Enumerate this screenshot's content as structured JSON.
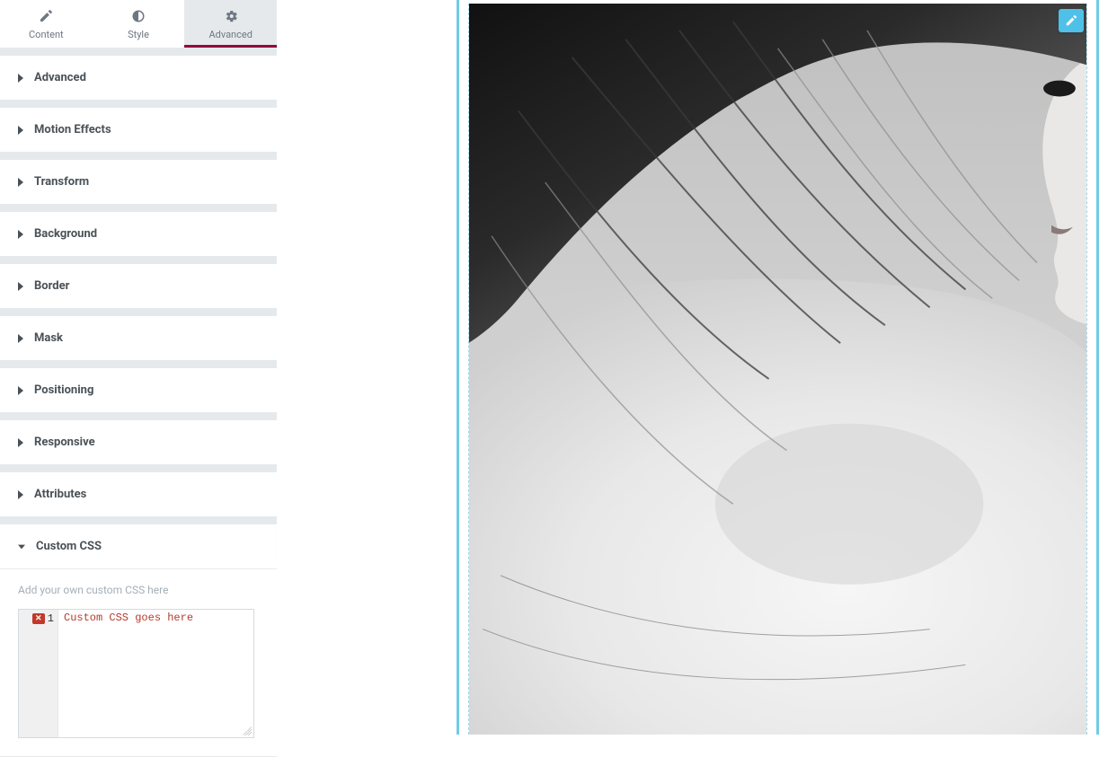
{
  "tabs": {
    "content": "Content",
    "style": "Style",
    "advanced": "Advanced"
  },
  "sections": {
    "advanced": "Advanced",
    "motion_effects": "Motion Effects",
    "transform": "Transform",
    "background": "Background",
    "border": "Border",
    "mask": "Mask",
    "positioning": "Positioning",
    "responsive": "Responsive",
    "attributes": "Attributes",
    "custom_css": "Custom CSS"
  },
  "custom_css": {
    "helper": "Add your own custom CSS here",
    "line_number": "1",
    "error_mark": "✕",
    "code": "Custom CSS goes here"
  },
  "colors": {
    "accent": "#93003c",
    "frame": "#71cbe4",
    "badge": "#4fc1e9"
  }
}
